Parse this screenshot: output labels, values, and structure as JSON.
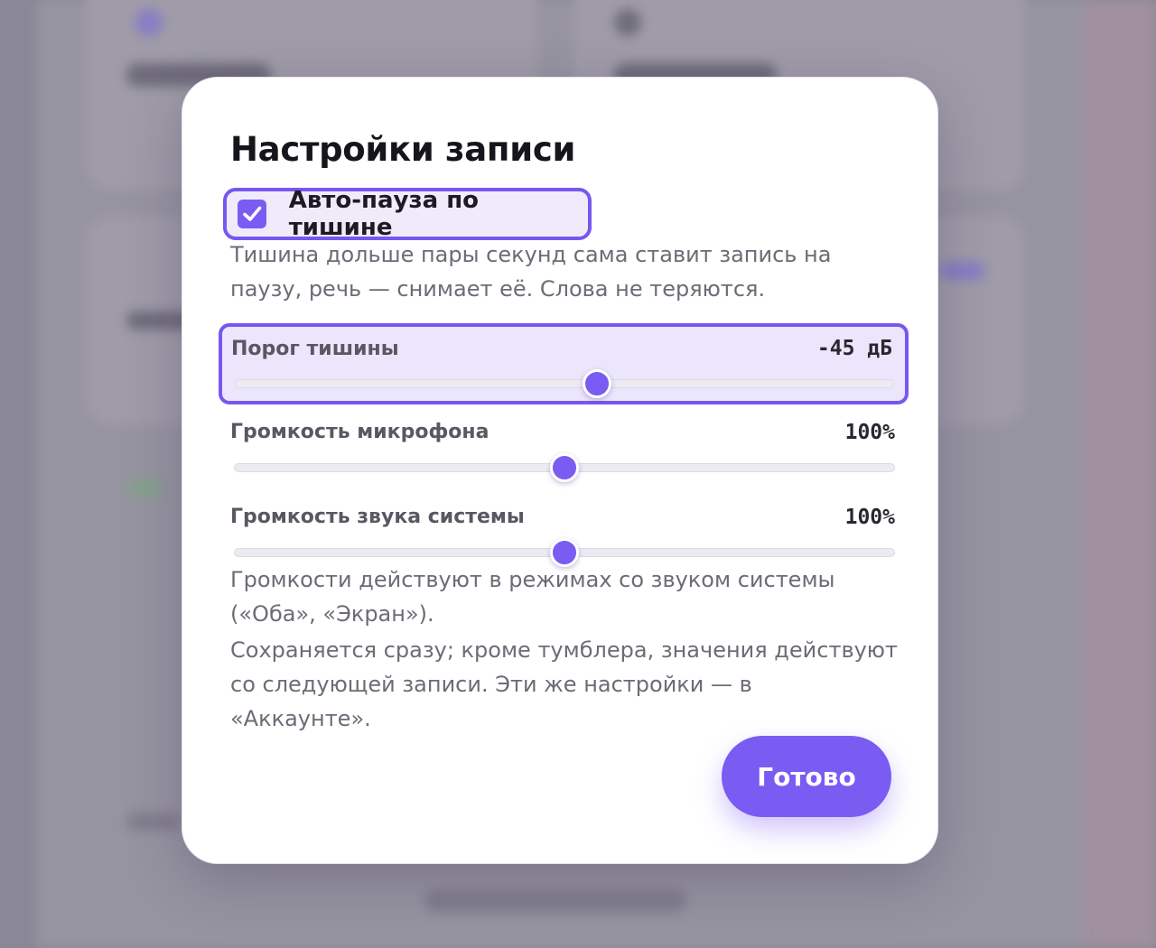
{
  "dialog": {
    "title": "Настройки записи",
    "auto_pause": {
      "label": "Авто-пауза по тишине",
      "checked": true,
      "description": "Тишина дольше пары секунд сама ставит запись на паузу, речь — снимает её. Слова не теряются."
    },
    "sliders": [
      {
        "label": "Порог тишины",
        "value_text": "-45 дБ",
        "fraction": 0.55
      },
      {
        "label": "Громкость микрофона",
        "value_text": "100%",
        "fraction": 0.5
      },
      {
        "label": "Громкость звука системы",
        "value_text": "100%",
        "fraction": 0.5
      }
    ],
    "note_1": "Громкости действуют в режимах со звуком системы («Оба», «Экран»).",
    "note_2": "Сохраняется сразу; кроме тумблера, значения действуют со следующей записи. Эти же настройки — в «Аккаунте».",
    "done_label": "Готово"
  },
  "colors": {
    "accent": "#7A5CF3",
    "focus_ring": "#7757F0",
    "overlay": "#8E8B99"
  }
}
